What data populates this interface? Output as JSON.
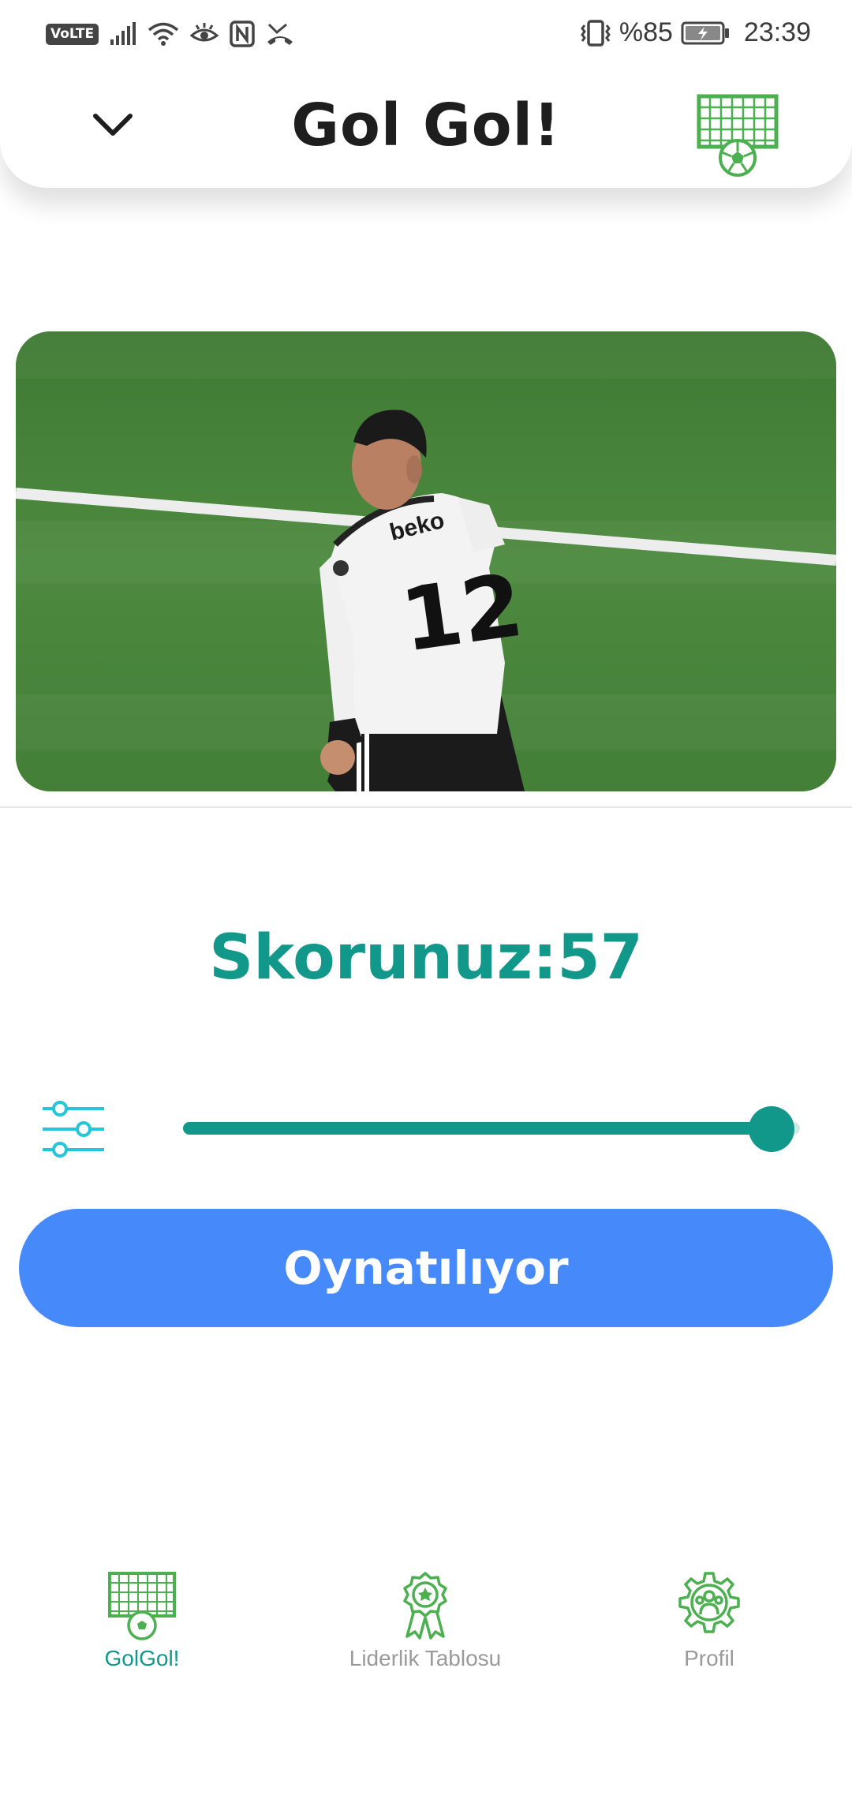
{
  "status_bar": {
    "volte": "VoLTE",
    "battery": "%85",
    "time": "23:39",
    "icons": [
      "signal-icon",
      "wifi-icon",
      "eye-comfort-icon",
      "nfc-icon",
      "missed-call-icon",
      "vibrate-icon",
      "battery-charging-icon"
    ]
  },
  "header": {
    "title": "Gol Gol!",
    "left_icon": "chevron-down-icon",
    "right_icon": "goal-net-icon"
  },
  "video": {
    "jersey_text": "beko",
    "jersey_number": "12"
  },
  "score": {
    "text": "Skorunuz:57"
  },
  "playback": {
    "progress": 0.99,
    "settings_icon": "sliders-icon",
    "button_label": "Oynatılıyor"
  },
  "bottom_nav": {
    "items": [
      {
        "label": "GolGol!",
        "icon": "goal-net-icon",
        "active": true
      },
      {
        "label": "Liderlik Tablosu",
        "icon": "award-ribbon-icon",
        "active": false
      },
      {
        "label": "Profil",
        "icon": "profile-gear-icon",
        "active": false
      }
    ]
  },
  "colors": {
    "accent": "#11988a",
    "button": "#4689fa",
    "icon_green": "#4caf50",
    "settings_icon": "#26c6da",
    "inactive": "#9a9a9a"
  }
}
